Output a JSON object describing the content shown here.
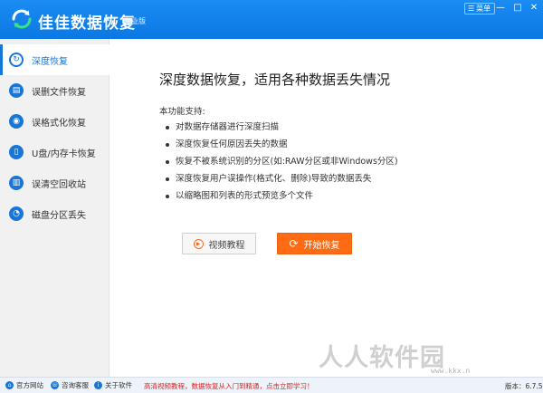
{
  "titlebar": {
    "app_title": "佳佳数据恢复",
    "edition": "专业版",
    "menu_label": "菜单",
    "minimize_glyph": "—",
    "maximize_glyph": "□",
    "close_glyph": "✕",
    "color": "#0b78e3"
  },
  "sidebar": {
    "items": [
      {
        "label": "深度恢复",
        "icon": "deep-recover-icon",
        "active": true
      },
      {
        "label": "误删文件恢复",
        "icon": "deleted-file-icon"
      },
      {
        "label": "误格式化恢复",
        "icon": "format-icon"
      },
      {
        "label": "U盘/内存卡恢复",
        "icon": "usb-card-icon"
      },
      {
        "label": "误清空回收站",
        "icon": "recycle-bin-icon"
      },
      {
        "label": "磁盘分区丢失",
        "icon": "partition-icon"
      }
    ]
  },
  "main": {
    "heading": "深度数据恢复，适用各种数据丢失情况",
    "intro": "本功能支持:",
    "features": [
      "对数据存储器进行深度扫描",
      "深度恢复任何原因丢失的数据",
      "恢复不被系统识别的分区(如:RAW分区或非Windows分区)",
      "深度恢复用户误操作(格式化、删除)导致的数据丢失",
      "以缩略图和列表的形式预览多个文件"
    ],
    "video_button": "视频教程",
    "start_button": "开始恢复",
    "accent_color": "#ff6b13"
  },
  "watermark": {
    "text": "人人软件园",
    "url": "www.kkx.n"
  },
  "statusbar": {
    "website": "官方网站",
    "support": "咨询客服",
    "about": "关于软件",
    "promo": "高清视频教程，数据恢复从入门到精通，点击立即学习！",
    "version": "版本：6.7.5"
  }
}
